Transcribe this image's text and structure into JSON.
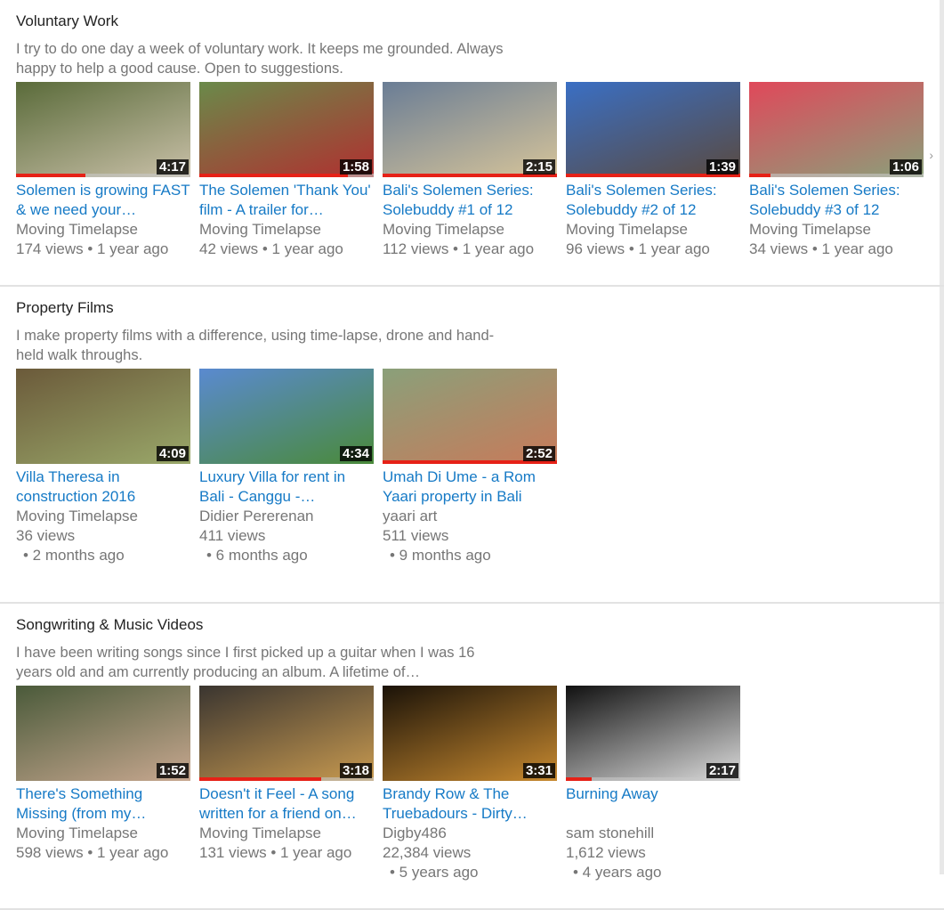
{
  "sections": [
    {
      "title": "Voluntary Work",
      "description": "I try to do one day a week of voluntary work. It keeps me grounded. Always happy to help a good cause. Open to suggestions.",
      "videos": [
        {
          "title": "Solemen is growing FAST & we need your…",
          "channel": "Moving Timelapse",
          "meta": "174 views • 1 year ago",
          "duration": "4:17",
          "progress": 0.4,
          "colors": [
            "#5a6b3a",
            "#c9c0a8"
          ]
        },
        {
          "title": "The Solemen 'Thank You' film - A trailer for…",
          "channel": "Moving Timelapse",
          "meta": "42 views • 1 year ago",
          "duration": "1:58",
          "progress": 0.85,
          "colors": [
            "#6a8a4a",
            "#b03030"
          ]
        },
        {
          "title": "Bali's Solemen Series: Solebuddy #1 of 12",
          "channel": "Moving Timelapse",
          "meta": "112 views • 1 year ago",
          "duration": "2:15",
          "progress": 1,
          "colors": [
            "#6a7d95",
            "#d6c49a"
          ]
        },
        {
          "title": "Bali's Solemen Series: Solebuddy #2 of 12",
          "channel": "Moving Timelapse",
          "meta": "96 views • 1 year ago",
          "duration": "1:39",
          "progress": 1,
          "colors": [
            "#3a6fc4",
            "#5a4a40"
          ]
        },
        {
          "title": "Bali's Solemen Series: Solebuddy #3 of 12",
          "channel": "Moving Timelapse",
          "meta": "34 views • 1 year ago",
          "duration": "1:06",
          "progress": 0.12,
          "colors": [
            "#e0485a",
            "#8aa07a"
          ]
        }
      ]
    },
    {
      "title": "Property Films",
      "description": "I make property films with a difference, using time-lapse, drone and hand-held walk throughs.",
      "videos": [
        {
          "title": "Villa Theresa in construction 2016",
          "channel": "Moving Timelapse",
          "meta": "36 views",
          "age": "• 2 months ago",
          "duration": "4:09",
          "progress": 0,
          "colors": [
            "#6b5a3a",
            "#9aa86a"
          ]
        },
        {
          "title": "Luxury Villa for rent in Bali - Canggu -…",
          "channel": "Didier Pererenan",
          "meta": "411 views",
          "age": "• 6 months ago",
          "duration": "4:34",
          "progress": 0,
          "colors": [
            "#5a8ad0",
            "#4a8a3a"
          ]
        },
        {
          "title": "Umah Di Ume - a Rom Yaari property in Bali",
          "channel": "yaari art",
          "meta": "511 views",
          "age": "• 9 months ago",
          "duration": "2:52",
          "progress": 1,
          "colors": [
            "#8aa07a",
            "#c87a5a"
          ]
        }
      ]
    },
    {
      "title": "Songwriting & Music Videos",
      "description": "I have been writing songs since I first picked up a guitar when I was 16 years old and am currently producing an album. A lifetime of…",
      "videos": [
        {
          "title": "There's Something Missing (from my…",
          "channel": "Moving Timelapse",
          "meta": "598 views • 1 year ago",
          "duration": "1:52",
          "progress": 0,
          "colors": [
            "#4a5a3a",
            "#c8a890"
          ]
        },
        {
          "title": "Doesn't it Feel - A song written for a friend on…",
          "channel": "Moving Timelapse",
          "meta": "131 views • 1 year ago",
          "duration": "3:18",
          "progress": 0.7,
          "colors": [
            "#3a3530",
            "#c89a50"
          ]
        },
        {
          "title": "Brandy Row & The Truebadours - Dirty…",
          "channel": "Digby486",
          "meta": "22,384 views",
          "age": "• 5 years ago",
          "duration": "3:31",
          "progress": 0,
          "colors": [
            "#1a1208",
            "#c88a30"
          ]
        },
        {
          "title": "Burning Away",
          "channel": "sam stonehill",
          "meta": "1,612 views",
          "age": "• 4 years ago",
          "duration": "2:17",
          "progress": 0.15,
          "colors": [
            "#111",
            "#ddd"
          ]
        }
      ]
    }
  ]
}
